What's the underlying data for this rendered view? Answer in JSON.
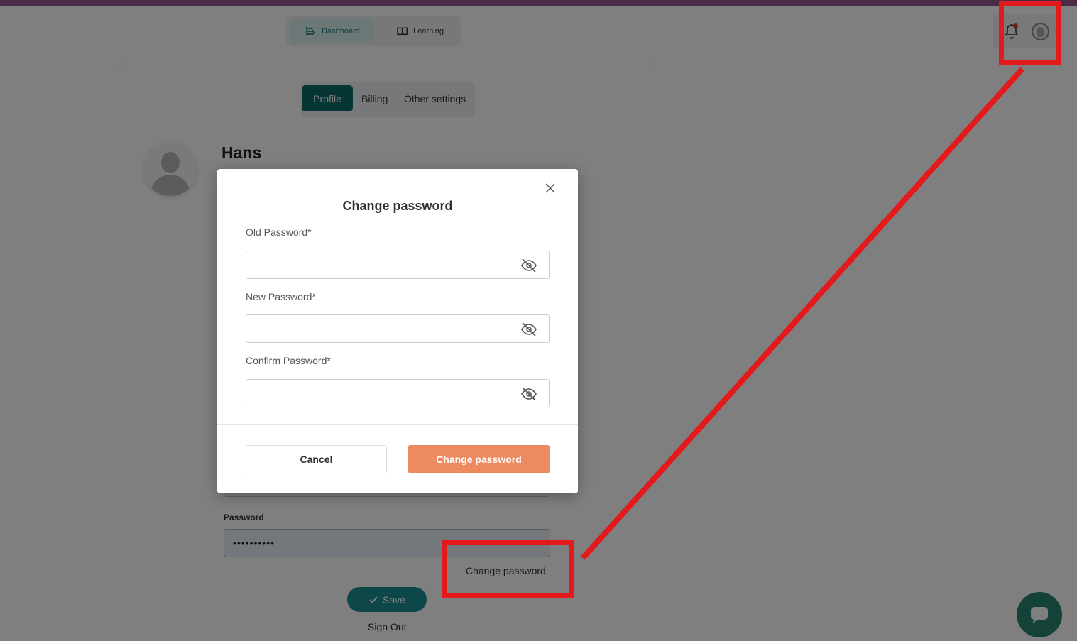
{
  "nav": {
    "dashboard": "Dashboard",
    "learning": "Learning"
  },
  "profile": {
    "tabs": [
      "Profile",
      "Billing",
      "Other settings"
    ],
    "name": "Hans",
    "password_label": "Password",
    "password_value": "••••••••••",
    "change_password_link": "Change password",
    "save_label": "Save",
    "sign_out": "Sign Out"
  },
  "modal": {
    "title": "Change password",
    "old_password_label": "Old Password*",
    "new_password_label": "New Password*",
    "confirm_password_label": "Confirm Password*",
    "old_password_value": "",
    "new_password_value": "",
    "confirm_password_value": "",
    "cancel_label": "Cancel",
    "submit_label": "Change password"
  },
  "colors": {
    "accent": "#0e6b6b",
    "primary_button": "#ee8a5f",
    "annotation": "#e3191b",
    "notification_dot": "#e13b2b"
  },
  "icons": [
    "dashboard-icon",
    "book-icon",
    "bell-icon",
    "avatar-icon",
    "close-icon",
    "eye-off-icon",
    "check-icon",
    "chat-icon"
  ]
}
